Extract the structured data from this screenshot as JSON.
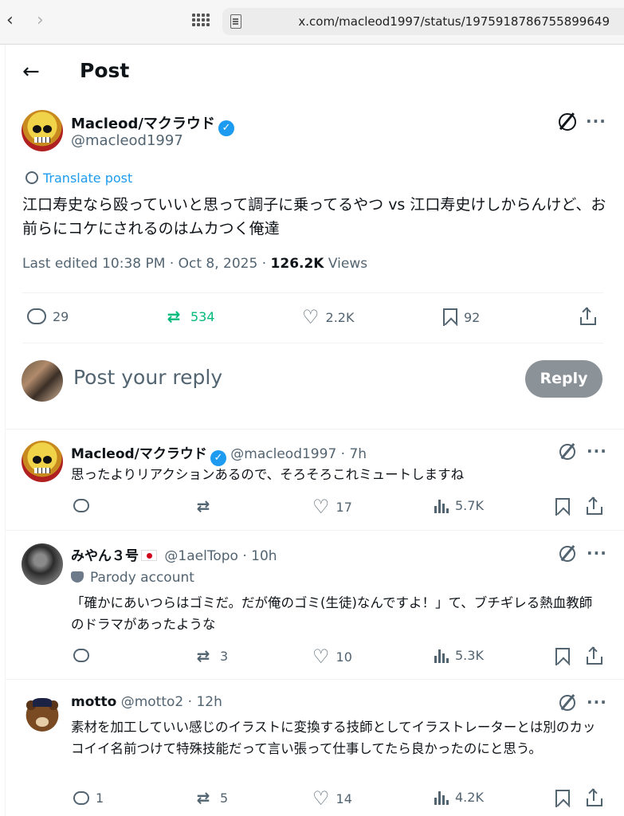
{
  "browser": {
    "url": "x.com/macleod1997/status/1975918786755899649"
  },
  "header": {
    "title": "Post"
  },
  "main_tweet": {
    "author_name": "Macleod/マクラウド",
    "handle": "@macleod1997",
    "translate_label": "Translate post",
    "body": "江口寿史なら殴っていいと思って調子に乗ってるやつ vs 江口寿史けしからんけど、お前らにコケにされるのはムカつく俺達",
    "edited": "Last edited 10:38 PM · Oct 8, 2025 · ",
    "views_count": "126.2K",
    "views_label": " Views",
    "replies": "29",
    "reposts": "534",
    "likes": "2.2K",
    "bookmarks": "92"
  },
  "compose": {
    "placeholder": "Post your reply",
    "reply_button": "Reply"
  },
  "replies": [
    {
      "name": "Macleod/マクラウド",
      "handle": "@macleod1997",
      "time": " · 7h",
      "body": "思ったよりリアクションあるので、そろそろこれミュートしますね",
      "replies": "",
      "reposts": "",
      "likes": "17",
      "views": "5.7K"
    },
    {
      "name": "みやん３号",
      "handle": "@1aelTopo",
      "time": " · 10h",
      "parody": "Parody account",
      "body": "「確かにあいつらはゴミだ。だが俺のゴミ(生徒)なんですよ！」て、ブチギレる熱血教師のドラマがあったような",
      "replies": "",
      "reposts": "3",
      "likes": "10",
      "views": "5.3K"
    },
    {
      "name": "motto",
      "handle": "@motto2",
      "time": " · 12h",
      "body": "素材を加工していい感じのイラストに変換する技師としてイラストレーターとは別のカッコイイ名前つけて特殊技能だって言い張って仕事してたら良かったのにと思う。",
      "replies": "1",
      "reposts": "5",
      "likes": "14",
      "views": "4.2K"
    }
  ],
  "icons": {
    "back": "arrow-left-icon",
    "verified": "verified-badge-icon",
    "grok": "grok-icon",
    "more": "more-icon",
    "accent": "#1d9bf0",
    "repost_active": "#00ba7c"
  }
}
